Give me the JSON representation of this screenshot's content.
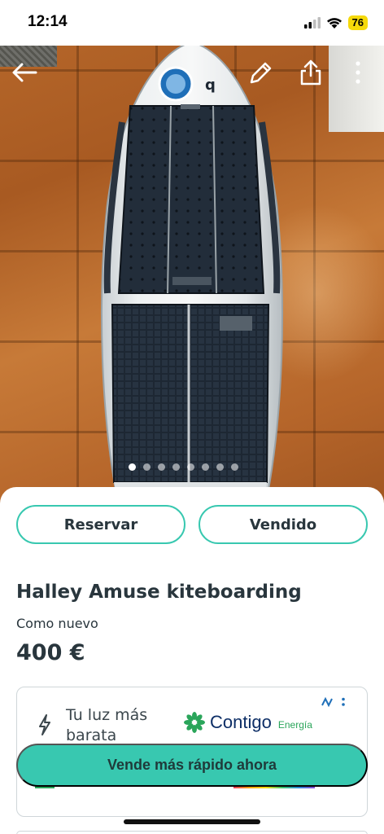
{
  "status_bar": {
    "time": "12:14",
    "battery": "76",
    "icons": [
      "signal-icon",
      "wifi-icon",
      "battery-icon"
    ]
  },
  "photo": {
    "slide_count": 8,
    "active_slide": 1,
    "icons": [
      "back-arrow-icon",
      "edit-pencil-icon",
      "share-icon",
      "more-vertical-icon"
    ]
  },
  "actions": {
    "reserve_label": "Reservar",
    "sold_label": "Vendido"
  },
  "listing": {
    "title": "Halley Amuse kiteboarding",
    "condition": "Como nuevo",
    "price": "400 €"
  },
  "ad": {
    "text": "Tu luz más barata",
    "brand": "Contigo",
    "brand_sub": "Energía"
  },
  "cta": {
    "label": "Vende más rápido ahora"
  },
  "colors": {
    "accent": "#38c8b0",
    "text": "#29363d",
    "battery": "#f5d90a"
  }
}
